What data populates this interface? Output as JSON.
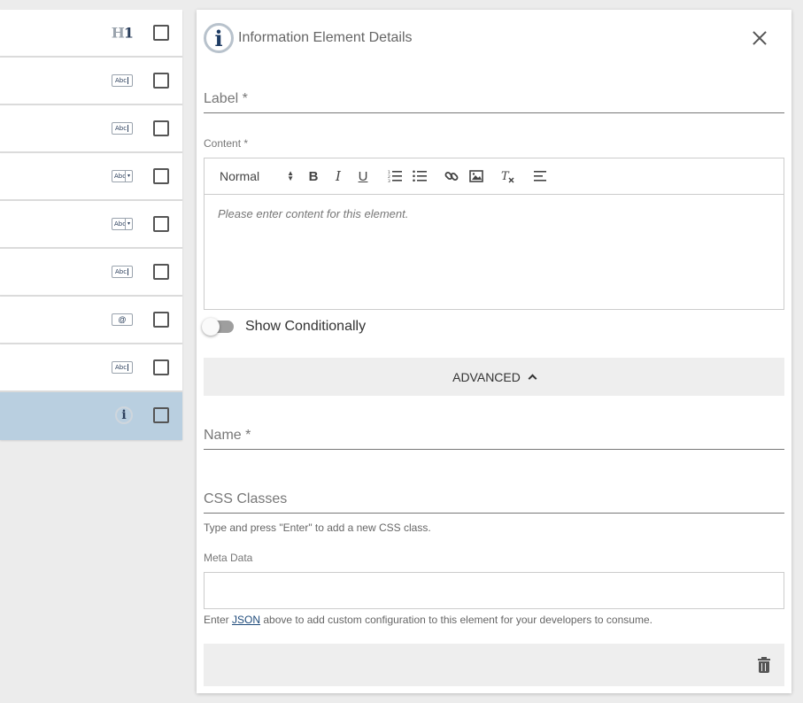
{
  "left_list": {
    "items": [
      {
        "icon": "heading-icon",
        "h_char": "H",
        "one_char": "1"
      },
      {
        "icon": "text-field-icon",
        "text": "Abc"
      },
      {
        "icon": "text-field-icon",
        "text": "Abc"
      },
      {
        "icon": "dropdown-icon",
        "text": "Abc",
        "arrow": "▾"
      },
      {
        "icon": "dropdown-icon",
        "text": "Abc",
        "arrow": "▾"
      },
      {
        "icon": "text-field-icon",
        "text": "Abc"
      },
      {
        "icon": "email-field-icon",
        "text": "@"
      },
      {
        "icon": "text-field-icon",
        "text": "Abc"
      },
      {
        "icon": "info-icon",
        "text": "i",
        "selected": true
      }
    ]
  },
  "panel": {
    "title": "Information Element Details",
    "icon_glyph": "i",
    "label_field": {
      "placeholder": "Label *",
      "value": ""
    },
    "content_label": "Content *",
    "toolbar": {
      "format_select": "Normal",
      "bold": "B",
      "italic": "I",
      "underline": "U",
      "ordered_list": "☰",
      "bullet_list": "☰",
      "link": "🔗",
      "image": "▣",
      "clear_format": "Tx",
      "align": "≡"
    },
    "content_placeholder": "Please enter content for this element.",
    "show_conditionally_label": "Show Conditionally",
    "advanced_label": "ADVANCED",
    "name_field": {
      "placeholder": "Name *",
      "value": ""
    },
    "css_field": {
      "placeholder": "CSS Classes",
      "value": ""
    },
    "css_helper": "Type and press \"Enter\" to add a new CSS class.",
    "meta_label": "Meta Data",
    "meta_helper_pre": "Enter ",
    "meta_helper_link": "JSON",
    "meta_helper_post": " above to add custom configuration to this element for your developers to consume."
  }
}
